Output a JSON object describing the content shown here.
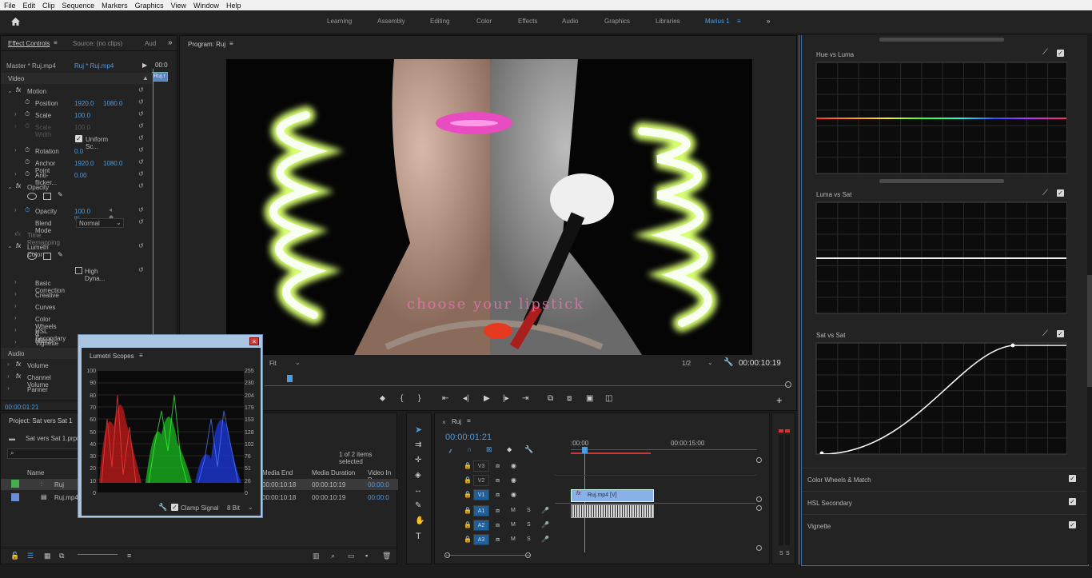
{
  "menu": [
    "File",
    "Edit",
    "Clip",
    "Sequence",
    "Markers",
    "Graphics",
    "View",
    "Window",
    "Help"
  ],
  "workspaces": [
    "Learning",
    "Assembly",
    "Editing",
    "Color",
    "Effects",
    "Audio",
    "Graphics",
    "Libraries",
    "Marius 1"
  ],
  "effect_controls": {
    "tabs": [
      "Effect Controls",
      "Source: (no clips)",
      "Aud"
    ],
    "master": "Master * Ruj.mp4",
    "clip": "Ruj * Ruj.mp4",
    "clip_short": "Ruj.r",
    "tc_head": "00:0",
    "video": "Video",
    "audio": "Audio",
    "motion": "Motion",
    "position": "Position",
    "pos_x": "1920.0",
    "pos_y": "1080.0",
    "scale": "Scale",
    "scale_v": "100.0",
    "scale_width": "Scale Width",
    "scale_width_v": "100.0",
    "uniform": "Uniform Sc...",
    "rotation": "Rotation",
    "rotation_v": "0.0",
    "anchor": "Anchor Point",
    "anc_x": "1920.0",
    "anc_y": "1080.0",
    "antiflicker": "Anti-flicker...",
    "antiflicker_v": "0.00",
    "opacity_fx": "Opacity",
    "opacity": "Opacity",
    "opacity_v": "100.0 %",
    "blend": "Blend Mode",
    "blend_v": "Normal",
    "time_remap": "Time Remapping",
    "lumetri": "Lumetri Color",
    "high_dyn": "High Dyna...",
    "basic": "Basic Correction",
    "creative": "Creative",
    "curves": "Curves",
    "wheels": "Color Wheels & Match",
    "hsl": "HSL Secondary",
    "vignette": "Vignette",
    "volume": "Volume",
    "channel_volume": "Channel Volume",
    "panner": "Panner",
    "timecode": "00:00:01:21"
  },
  "program": {
    "title": "Program: Ruj",
    "fit": "Fit",
    "res": "1/2",
    "timecode": "00:00:10:19",
    "caption": "choose your lipstick"
  },
  "scopes": {
    "title": "Lumetri Scopes",
    "left_ticks": [
      "100",
      "90",
      "80",
      "70",
      "60",
      "50",
      "40",
      "30",
      "20",
      "10",
      "0"
    ],
    "right_ticks": [
      "255",
      "230",
      "204",
      "179",
      "153",
      "128",
      "102",
      "76",
      "51",
      "26",
      "0"
    ],
    "clamp": "Clamp Signal",
    "bits": "8 Bit"
  },
  "project": {
    "title": "Project: Sat vers Sat 1",
    "file": "Sat vers Sat 1.prpro",
    "items_count": "1 of 2 items selected",
    "name_col": "Name",
    "cols": [
      "Media End",
      "Media Duration",
      "Video In P"
    ],
    "rows": [
      {
        "name": "Ruj",
        "color": "#44b04a",
        "end": "00:00:10:18",
        "dur": "00:00:10:19",
        "vin": "00:00:0"
      },
      {
        "name": "Ruj.mp4",
        "color": "#6a8fd8",
        "end": "00:00:10:18",
        "dur": "00:00:10:19",
        "vin": "00:00:0"
      }
    ]
  },
  "timeline": {
    "seq": "Ruj",
    "timecode": "00:00:01:21",
    "ruler0": ":00:00",
    "ruler1": "00:00:15:00",
    "video_tracks": [
      "V3",
      "V2",
      "V1"
    ],
    "audio_tracks": [
      "A1",
      "A2",
      "A3"
    ],
    "clip_label": "Ruj.mp4 [V]",
    "m": "M",
    "s": "S"
  },
  "lumetri": {
    "curves": [
      {
        "name": "Hue vs Luma"
      },
      {
        "name": "Luma vs Sat"
      },
      {
        "name": "Sat vs Sat"
      }
    ],
    "sections": [
      "Color Wheels & Match",
      "HSL Secondary",
      "Vignette"
    ]
  },
  "meter": {
    "s1": "S",
    "s2": "S"
  },
  "icons": [
    "home-icon",
    "wrench-icon",
    "play-icon",
    "pen-icon",
    "hand-icon",
    "type-icon",
    "eyedropper-icon"
  ]
}
